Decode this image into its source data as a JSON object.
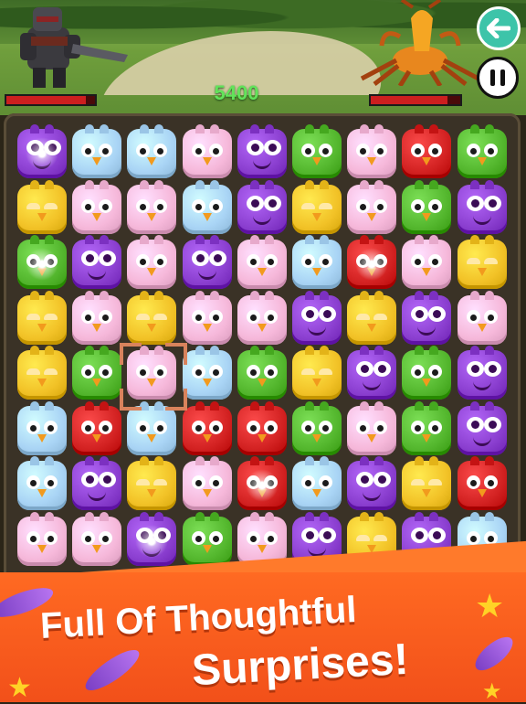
{
  "hud": {
    "score": "5400",
    "player_health": 0.9,
    "enemy_health": 0.86
  },
  "buttons": {
    "back_icon": "back-arrow-icon",
    "pause_icon": "pause-icon"
  },
  "board": {
    "columns": 9,
    "rows": 8,
    "selected": [
      2,
      4
    ],
    "tiles": [
      [
        "purple-sparkle",
        "blue",
        "blue",
        "pink",
        "purple",
        "green",
        "pink",
        "red",
        "green"
      ],
      [
        "yellow",
        "pink",
        "pink",
        "blue",
        "purple",
        "yellow",
        "pink",
        "green",
        "purple"
      ],
      [
        "green-sparkle",
        "purple",
        "pink",
        "purple",
        "pink",
        "blue",
        "red-sparkle",
        "pink",
        "yellow"
      ],
      [
        "yellow",
        "pink",
        "yellow",
        "pink",
        "pink",
        "purple",
        "yellow",
        "purple",
        "pink"
      ],
      [
        "yellow",
        "green",
        "pink",
        "blue",
        "green",
        "yellow",
        "purple",
        "green",
        "purple"
      ],
      [
        "blue",
        "red",
        "blue",
        "red",
        "red",
        "green",
        "pink",
        "green",
        "purple"
      ],
      [
        "blue",
        "purple",
        "yellow",
        "pink",
        "red-sparkle",
        "blue",
        "purple",
        "yellow",
        "red"
      ],
      [
        "pink",
        "pink",
        "purple-sparkle",
        "green",
        "pink",
        "purple",
        "yellow",
        "purple",
        "blue"
      ]
    ],
    "colors": {
      "blue": "#a9d4f5",
      "pink": "#f6b8da",
      "purple": "#8b3fd0",
      "green": "#54b72e",
      "yellow": "#f2c227",
      "red": "#d32222"
    }
  },
  "banner": {
    "line1": "Full Of Thoughtful",
    "line2": "Surprises!",
    "background": "#f2541c"
  }
}
